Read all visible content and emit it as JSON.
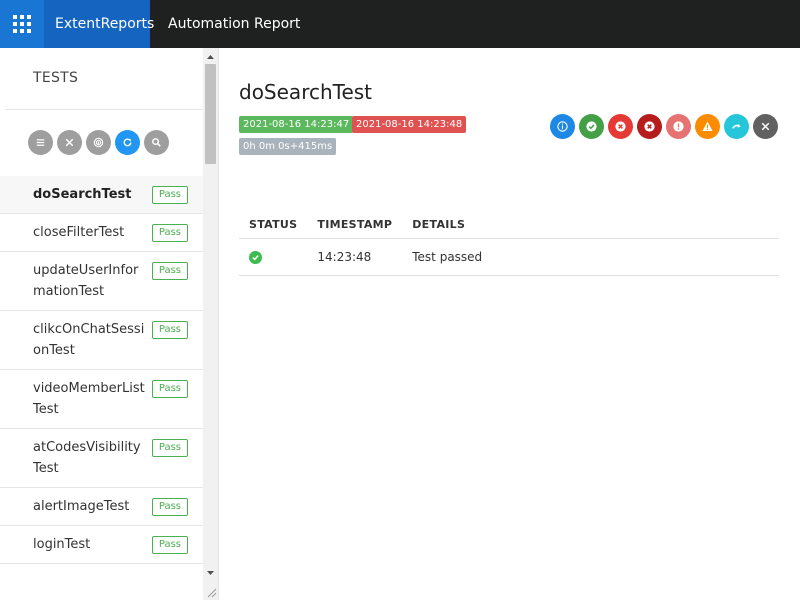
{
  "topbar": {
    "brand": "ExtentReports",
    "title": "Automation Report",
    "apps_icon": "grid-icon",
    "bg_color": "#1e2120",
    "accent_color": "#1565c0"
  },
  "sidebar": {
    "title": "TESTS",
    "filters": [
      {
        "icon": "list-icon"
      },
      {
        "icon": "close-icon"
      },
      {
        "icon": "fingerprint-icon"
      },
      {
        "icon": "refresh-icon"
      },
      {
        "icon": "search-icon"
      }
    ],
    "tests": [
      {
        "name": "doSearchTest",
        "status": "Pass"
      },
      {
        "name": "closeFilterTest",
        "status": "Pass"
      },
      {
        "name": "updateUserInformationTest",
        "status": "Pass"
      },
      {
        "name": "clikcOnChatSessionTest",
        "status": "Pass"
      },
      {
        "name": "videoMemberListTest",
        "status": "Pass"
      },
      {
        "name": "atCodesVisibilityTest",
        "status": "Pass"
      },
      {
        "name": "alertImageTest",
        "status": "Pass"
      },
      {
        "name": "loginTest",
        "status": "Pass"
      }
    ]
  },
  "detail": {
    "title": "doSearchTest",
    "start_time": "2021-08-16 14:23:47",
    "end_time": "2021-08-16 14:23:48",
    "duration": "0h 0m 0s+415ms",
    "status_filters": [
      {
        "icon": "info-icon",
        "color": "#1e88e5"
      },
      {
        "icon": "check-icon",
        "color": "#43a047"
      },
      {
        "icon": "x-icon",
        "color": "#e53935"
      },
      {
        "icon": "x-icon",
        "color": "#b71c1c"
      },
      {
        "icon": "exclamation-icon",
        "color": "#e57373"
      },
      {
        "icon": "warning-icon",
        "color": "#fb8c00"
      },
      {
        "icon": "skip-icon",
        "color": "#26c6da"
      },
      {
        "icon": "close-icon",
        "color": "#616161"
      }
    ],
    "table": {
      "headers": [
        "STATUS",
        "TIMESTAMP",
        "DETAILS"
      ],
      "rows": [
        {
          "status_icon": "check-circle-icon",
          "timestamp": "14:23:48",
          "details": "Test passed"
        }
      ]
    }
  }
}
